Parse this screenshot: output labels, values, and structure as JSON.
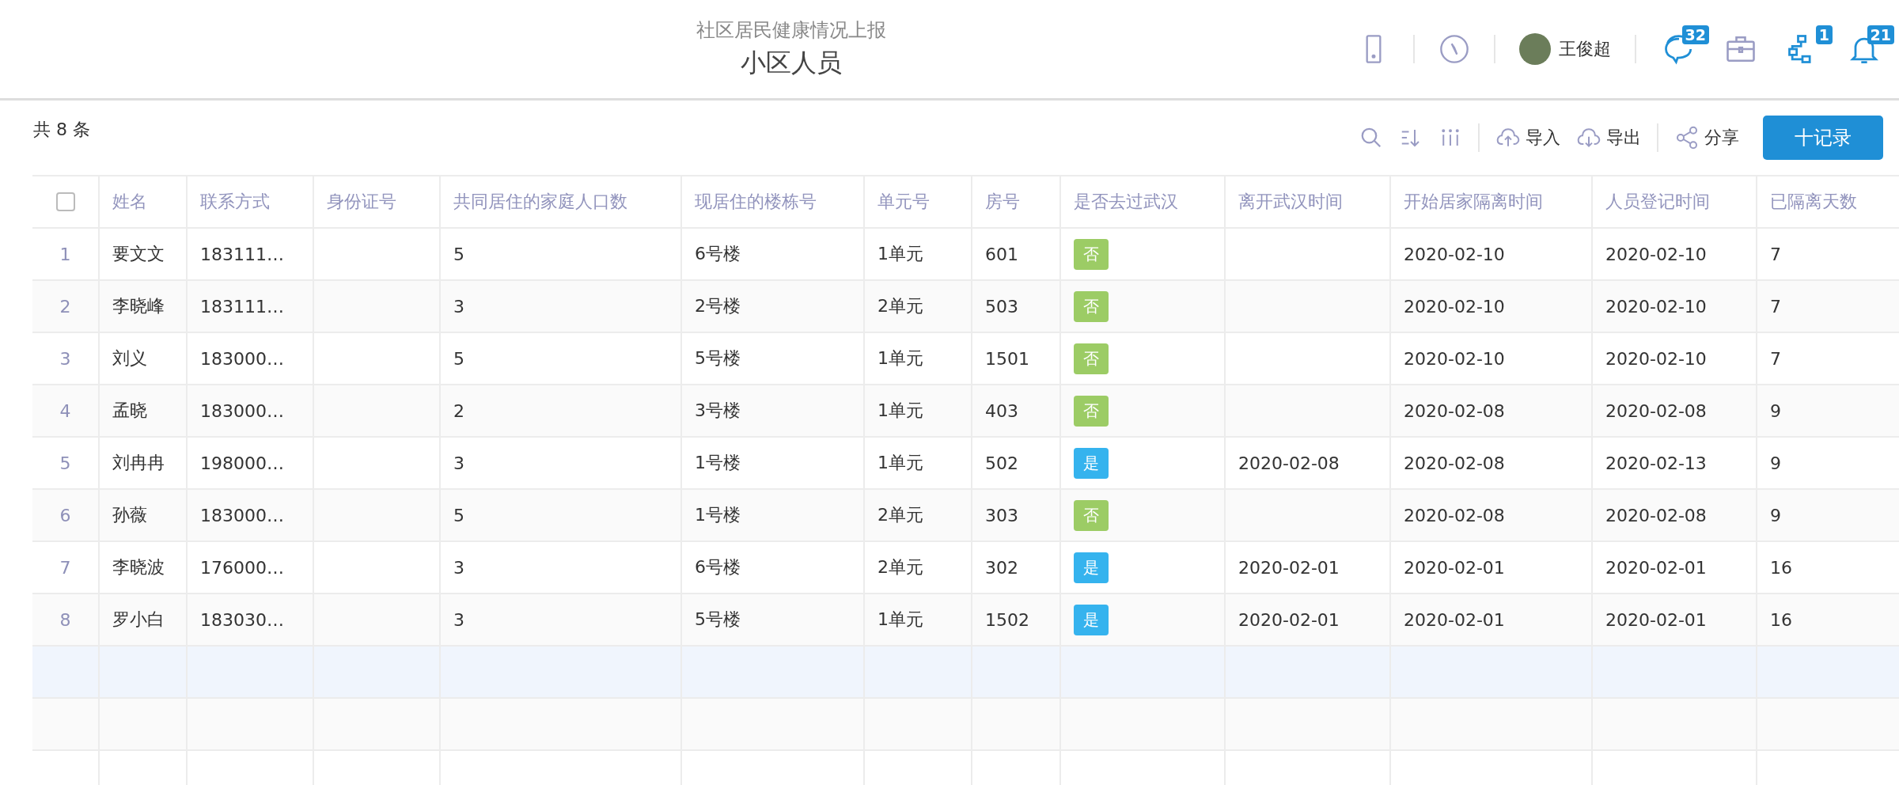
{
  "header": {
    "subtitle": "社区居民健康情况上报",
    "title": "小区人员",
    "user_name": "王俊超",
    "badges": [
      {
        "kind": "chat",
        "count": "32"
      },
      {
        "kind": "briefcase"
      },
      {
        "kind": "flow",
        "count": "1"
      },
      {
        "kind": "bell",
        "count": "21"
      }
    ]
  },
  "toolbar": {
    "count_label": "共 8 条",
    "actions": [
      "导入",
      "导出",
      "分享"
    ],
    "add_button": "十记录"
  },
  "table": {
    "columns": [
      "姓名",
      "联系方式",
      "身份证号",
      "共同居住的家庭人口数",
      "现居住的楼栋号",
      "单元号",
      "房号",
      "是否去过武汉",
      "离开武汉时间",
      "开始居家隔离时间",
      "人员登记时间",
      "已隔离天数"
    ],
    "rows": [
      {
        "index": "1",
        "name": "要文文",
        "phone": "183111…",
        "household": "5",
        "building": "6号楼",
        "unit": "1单元",
        "room": "601",
        "wuhan": {
          "text": "否",
          "color": "#9ccc65"
        },
        "isolation_start": "2020-02-10",
        "registered": "2020-02-10",
        "days": "7"
      },
      {
        "index": "2",
        "name": "李晓峰",
        "phone": "183111…",
        "household": "3",
        "building": "2号楼",
        "unit": "2单元",
        "room": "503",
        "wuhan": {
          "text": "否",
          "color": "#9ccc65"
        },
        "isolation_start": "2020-02-10",
        "registered": "2020-02-10",
        "days": "7"
      },
      {
        "index": "3",
        "name": "刘义",
        "phone": "183000…",
        "household": "5",
        "building": "5号楼",
        "unit": "1单元",
        "room": "1501",
        "wuhan": {
          "text": "否",
          "color": "#9ccc65"
        },
        "isolation_start": "2020-02-10",
        "registered": "2020-02-10",
        "days": "7"
      },
      {
        "index": "4",
        "name": "孟晓",
        "phone": "183000…",
        "household": "2",
        "building": "3号楼",
        "unit": "1单元",
        "room": "403",
        "wuhan": {
          "text": "否",
          "color": "#9ccc65"
        },
        "isolation_start": "2020-02-08",
        "registered": "2020-02-08",
        "days": "9"
      },
      {
        "index": "5",
        "name": "刘冉冉",
        "phone": "198000…",
        "household": "3",
        "building": "1号楼",
        "unit": "1单元",
        "room": "502",
        "wuhan": {
          "text": "是",
          "color": "#35b3ee"
        },
        "left_wuhan": "2020-02-08",
        "isolation_start": "2020-02-08",
        "registered": "2020-02-13",
        "days": "9"
      },
      {
        "index": "6",
        "name": "孙薇",
        "phone": "183000…",
        "household": "5",
        "building": "1号楼",
        "unit": "2单元",
        "room": "303",
        "wuhan": {
          "text": "否",
          "color": "#9ccc65"
        },
        "isolation_start": "2020-02-08",
        "registered": "2020-02-08",
        "days": "9"
      },
      {
        "index": "7",
        "name": "李晓波",
        "phone": "176000…",
        "household": "3",
        "building": "6号楼",
        "unit": "2单元",
        "room": "302",
        "wuhan": {
          "text": "是",
          "color": "#35b3ee"
        },
        "left_wuhan": "2020-02-01",
        "isolation_start": "2020-02-01",
        "registered": "2020-02-01",
        "days": "16"
      },
      {
        "index": "8",
        "name": "罗小白",
        "phone": "183030…",
        "household": "3",
        "building": "5号楼",
        "unit": "1单元",
        "room": "1502",
        "wuhan": {
          "text": "是",
          "color": "#35b3ee"
        },
        "left_wuhan": "2020-02-01",
        "isolation_start": "2020-02-01",
        "registered": "2020-02-01",
        "days": "16"
      }
    ],
    "select_all": {
      "checked": false
    }
  }
}
